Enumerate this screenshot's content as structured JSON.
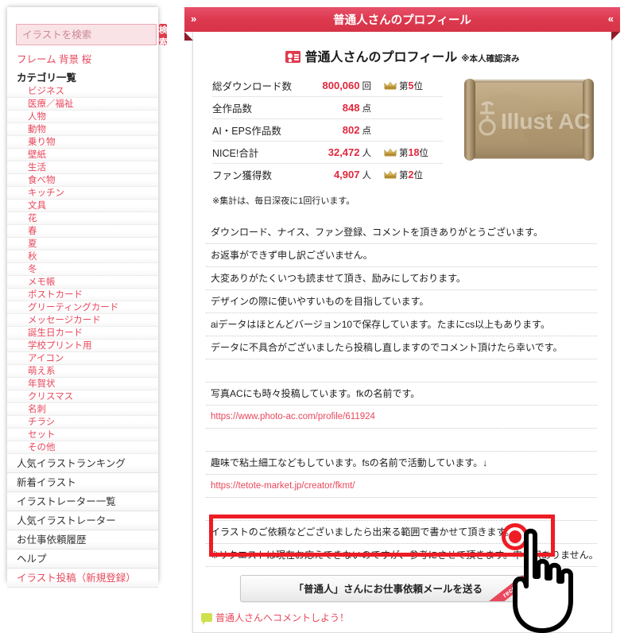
{
  "sidebar": {
    "search": {
      "placeholder": "イラストを検索",
      "value": "",
      "button_label": "検索"
    },
    "tags": [
      "フレーム",
      "背景",
      "桜"
    ],
    "category_header": "カテゴリ一覧",
    "categories": [
      "ビジネス",
      "医療／福祉",
      "人物",
      "動物",
      "乗り物",
      "壁紙",
      "生活",
      "食べ物",
      "キッチン",
      "文具",
      "花",
      "春",
      "夏",
      "秋",
      "冬",
      "メモ帳",
      "ポストカード",
      "グリーティングカード",
      "メッセージカード",
      "誕生日カード",
      "学校プリント用",
      "アイコン",
      "萌え系",
      "年賀状",
      "クリスマス",
      "名刺",
      "チラシ",
      "セット",
      "その他"
    ],
    "nav": [
      {
        "label": "人気イラストランキング",
        "accent": false
      },
      {
        "label": "新着イラスト",
        "accent": false
      },
      {
        "label": "イラストレーター一覧",
        "accent": false
      },
      {
        "label": "人気イラストレーター",
        "accent": false
      },
      {
        "label": "お仕事依頼履歴",
        "accent": false
      },
      {
        "label": "ヘルプ",
        "accent": false
      },
      {
        "label": "イラスト投稿（新規登録）",
        "accent": true
      }
    ]
  },
  "header": {
    "title": "普通人さんのプロフィール",
    "left_chevron": "»",
    "right_chevron": "«"
  },
  "profile": {
    "heading_name": "普通人",
    "heading_suffix": "さんのプロフィール",
    "verified_badge": "※本人確認済み",
    "avatar_alt": "Illust AC",
    "avatar_watermark": "Illust AC",
    "stats": [
      {
        "label": "総ダウンロード数",
        "value": "800,060",
        "unit": "回",
        "rank_prefix": "第",
        "rank": "5",
        "rank_suffix": "位",
        "has_rank": true
      },
      {
        "label": "全作品数",
        "value": "848",
        "unit": "点",
        "rank_prefix": "",
        "rank": "",
        "rank_suffix": "",
        "has_rank": false
      },
      {
        "label": "AI・EPS作品数",
        "value": "802",
        "unit": "点",
        "rank_prefix": "",
        "rank": "",
        "rank_suffix": "",
        "has_rank": false
      },
      {
        "label": "NICE!合計",
        "value": "32,472",
        "unit": "人",
        "rank_prefix": "第",
        "rank": "18",
        "rank_suffix": "位",
        "has_rank": true
      },
      {
        "label": "ファン獲得数",
        "value": "4,907",
        "unit": "人",
        "rank_prefix": "第",
        "rank": "2",
        "rank_suffix": "位",
        "has_rank": true
      }
    ],
    "aggregation_note": "※集計は、毎日深夜に1回行います。"
  },
  "body_lines": [
    {
      "text": "ダウンロード、ナイス、ファン登録、コメントを頂きありがとうございます。",
      "kind": "text"
    },
    {
      "text": "お返事ができず申し訳ございません。",
      "kind": "text"
    },
    {
      "text": "大変ありがたくいつも読ませて頂き、励みにしております。",
      "kind": "text"
    },
    {
      "text": "デザインの際に使いやすいものを目指しています。",
      "kind": "text"
    },
    {
      "text": "aiデータはほとんどバージョン10で保存しています。たまにcs以上もあります。",
      "kind": "text"
    },
    {
      "text": "データに不具合がございましたら投稿し直しますのでコメント頂けたら幸いです。",
      "kind": "text"
    },
    {
      "text": "",
      "kind": "blank"
    },
    {
      "text": "写真ACにも時々投稿しています。fkの名前です。",
      "kind": "text"
    },
    {
      "text": "https://www.photo-ac.com/profile/611924",
      "kind": "link"
    },
    {
      "text": "",
      "kind": "blank"
    },
    {
      "text": "趣味で粘土細工などもしています。fsの名前で活動しています。↓",
      "kind": "text"
    },
    {
      "text": "https://tetote-market.jp/creator/fkmt/",
      "kind": "link"
    },
    {
      "text": "",
      "kind": "blank"
    },
    {
      "text": "イラストのご依頼などございましたら出来る範囲で書かせて頂きます。",
      "kind": "text"
    },
    {
      "text": "※リクエストは現在お応えできないのですが、参考にさせて頂きます。申し訳ありません。",
      "kind": "text"
    }
  ],
  "cta": {
    "button_label": "「普通人」さんにお仕事依頼メールを送る",
    "ribbon_label": "recommend",
    "help_label": "?"
  },
  "comment": {
    "label": "普通人さんへコメントしよう！"
  },
  "annotations": {
    "highlight_color": "#ee1c24",
    "click_marker_color": "#ee1c24",
    "cursor": "pointing-hand"
  },
  "colors": {
    "brand_red": "#e13b4e",
    "link_red": "#e8485c",
    "value_red": "#e1273c",
    "header_red": "#dd3a50",
    "ribbon_shadow": "#8f1c2c"
  }
}
